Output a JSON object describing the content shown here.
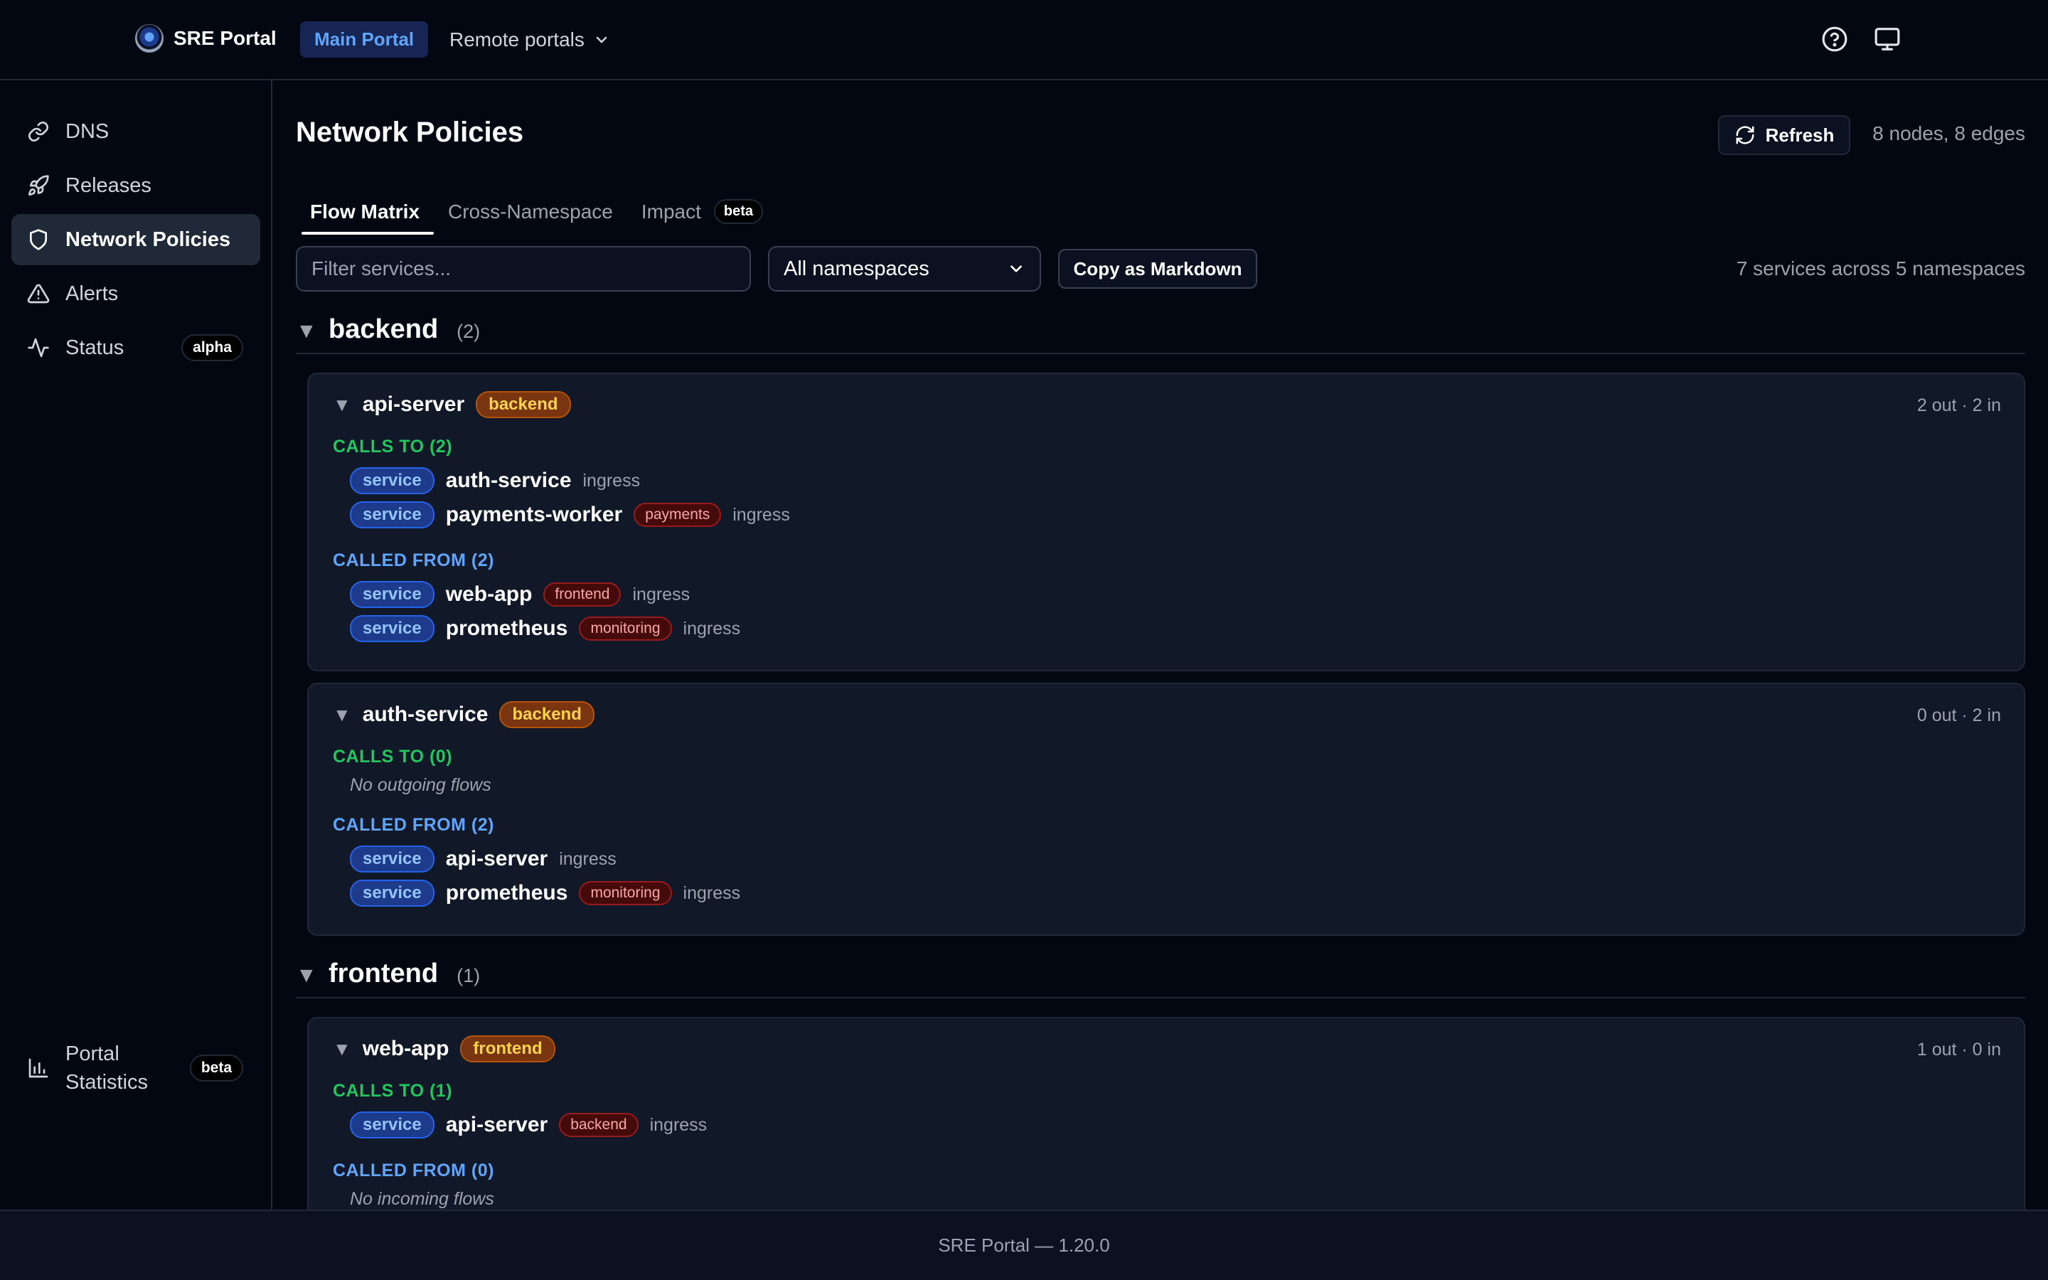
{
  "topbar": {
    "brand": "SRE Portal",
    "main_portal": "Main Portal",
    "remote_portals": "Remote portals"
  },
  "sidebar": {
    "items": [
      {
        "label": "DNS",
        "icon": "link-icon"
      },
      {
        "label": "Releases",
        "icon": "rocket-icon"
      },
      {
        "label": "Network Policies",
        "icon": "shield-icon",
        "active": true
      },
      {
        "label": "Alerts",
        "icon": "warning-icon"
      },
      {
        "label": "Status",
        "icon": "activity-icon",
        "badge": "alpha"
      }
    ],
    "statistics": {
      "label_line1": "Portal",
      "label_line2": "Statistics",
      "badge": "beta",
      "icon": "bar-chart-icon"
    }
  },
  "main": {
    "title": "Network Policies",
    "refresh_label": "Refresh",
    "graph_summary": "8 nodes, 8 edges",
    "tabs": [
      {
        "label": "Flow Matrix",
        "active": true
      },
      {
        "label": "Cross-Namespace"
      },
      {
        "label": "Impact",
        "badge": "beta"
      }
    ],
    "filter_placeholder": "Filter services...",
    "namespace_select": "All namespaces",
    "copy_markdown": "Copy as Markdown",
    "services_summary": "7 services across 5 namespaces"
  },
  "namespaces": [
    {
      "name": "backend",
      "count": "(2)",
      "services": [
        {
          "name": "api-server",
          "namespace": "backend",
          "meta": "2 out · 2 in",
          "calls_to_label": "CALLS TO (2)",
          "calls_to": [
            {
              "kind": "service",
              "target": "auth-service",
              "namespace": "",
              "direction": "ingress"
            },
            {
              "kind": "service",
              "target": "payments-worker",
              "namespace": "payments",
              "direction": "ingress"
            }
          ],
          "called_from_label": "CALLED FROM (2)",
          "called_from": [
            {
              "kind": "service",
              "target": "web-app",
              "namespace": "frontend",
              "direction": "ingress"
            },
            {
              "kind": "service",
              "target": "prometheus",
              "namespace": "monitoring",
              "direction": "ingress"
            }
          ]
        },
        {
          "name": "auth-service",
          "namespace": "backend",
          "meta": "0 out · 2 in",
          "calls_to_label": "CALLS TO (0)",
          "calls_to_empty": "No outgoing flows",
          "called_from_label": "CALLED FROM (2)",
          "called_from": [
            {
              "kind": "service",
              "target": "api-server",
              "namespace": "",
              "direction": "ingress"
            },
            {
              "kind": "service",
              "target": "prometheus",
              "namespace": "monitoring",
              "direction": "ingress"
            }
          ]
        }
      ]
    },
    {
      "name": "frontend",
      "count": "(1)",
      "services": [
        {
          "name": "web-app",
          "namespace": "frontend",
          "meta": "1 out · 0 in",
          "calls_to_label": "CALLS TO (1)",
          "calls_to": [
            {
              "kind": "service",
              "target": "api-server",
              "namespace": "backend",
              "direction": "ingress"
            }
          ],
          "called_from_label": "CALLED FROM (0)",
          "called_from_empty": "No incoming flows"
        }
      ]
    }
  ],
  "footer": {
    "version": "SRE Portal — 1.20.0"
  },
  "colors": {
    "background": "#030712",
    "card": "#111827",
    "accent_blue": "#60a5fa",
    "calls_to_green": "#22c55e",
    "namespace_amber": "#fcd34d"
  }
}
